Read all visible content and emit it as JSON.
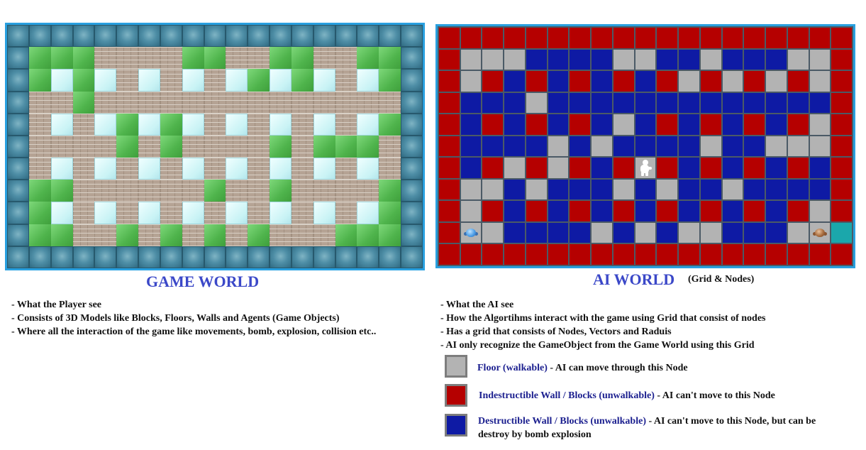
{
  "game_world": {
    "title": "GAME WORLD",
    "bullets": [
      "- What the Player see",
      "- Consists of 3D Models like Blocks, Floors, Walls and Agents (Game Objects)",
      "- Where all the interaction of the game like movements, bomb, explosion, collision etc.."
    ],
    "map": [
      "OOOOOOOOOOOOOOOOOOO",
      "OGGGBBBBGGBBGGBBGGO",
      "OGWGWBWBWBWGWGWBWGO",
      "OBBGBBBBBBBBBBBBBBO",
      "OBWBWGWGWBWBWBWBWGO",
      "OBBBBGBGBBBBGBGGGBO",
      "OBWBWBWBWBWBWBWBWBO",
      "OGGBBBBBBGBBGBBBBGO",
      "OGWBWBWBWBWBWBWBWGO",
      "OGGBBGBGBGBGBBBGGGO",
      "OOOOOOOOOOOOOOOOOOO"
    ]
  },
  "ai_world": {
    "title": "AI WORLD",
    "subtitle": "(Grid & Nodes)",
    "bullets": [
      "- What the AI see",
      "- How the Algortihms interact with the game using Grid that consist of nodes",
      "- Has a grid that consists of Nodes, Vectors and Raduis",
      "- AI only recognize the GameObject from the Game World using this Grid"
    ],
    "grid": [
      "RRRRRRRRRRRRRRRRRRR",
      "RFFFBBBBFFBBFBBBFFR",
      "RFRBRBRBRBRFRFRFRFR",
      "RBBBFBBBBBBBBBBBBBR",
      "RBRBRBRBFBRBRBRBRFR",
      "RBBBBFBFBBBBFBBFFFR",
      "RBRFRFRBRFRBRBRBRBR",
      "RFFBFBBBFBFBBFBBBBR",
      "RFRBRBRBRBRBRBRBRFR",
      "RFFBBBBFBFBFFBBBFFT",
      "RRRRRRRRRRRRRRRRRRR"
    ],
    "agents": [
      {
        "icon": "blue-agent-icon",
        "row": 9,
        "col": 1
      },
      {
        "icon": "white-agent-icon",
        "row": 6,
        "col": 9
      },
      {
        "icon": "brown-agent-icon",
        "row": 9,
        "col": 17
      }
    ],
    "legend": {
      "floor": {
        "term": "Floor (walkable)",
        "desc": " - AI can move through this Node",
        "color": "#b3b3b3"
      },
      "indestructible": {
        "term": "Indestructible Wall / Blocks (unwalkable)",
        "desc": " - AI can't move to this Node",
        "color": "#b50000"
      },
      "destructible": {
        "term": "Destructible Wall / Blocks (unwalkable)",
        "desc": " - AI can't move to this Node, but can be",
        "desc2": "destroy by bomb explosion",
        "color": "#0e1aa4"
      }
    }
  }
}
